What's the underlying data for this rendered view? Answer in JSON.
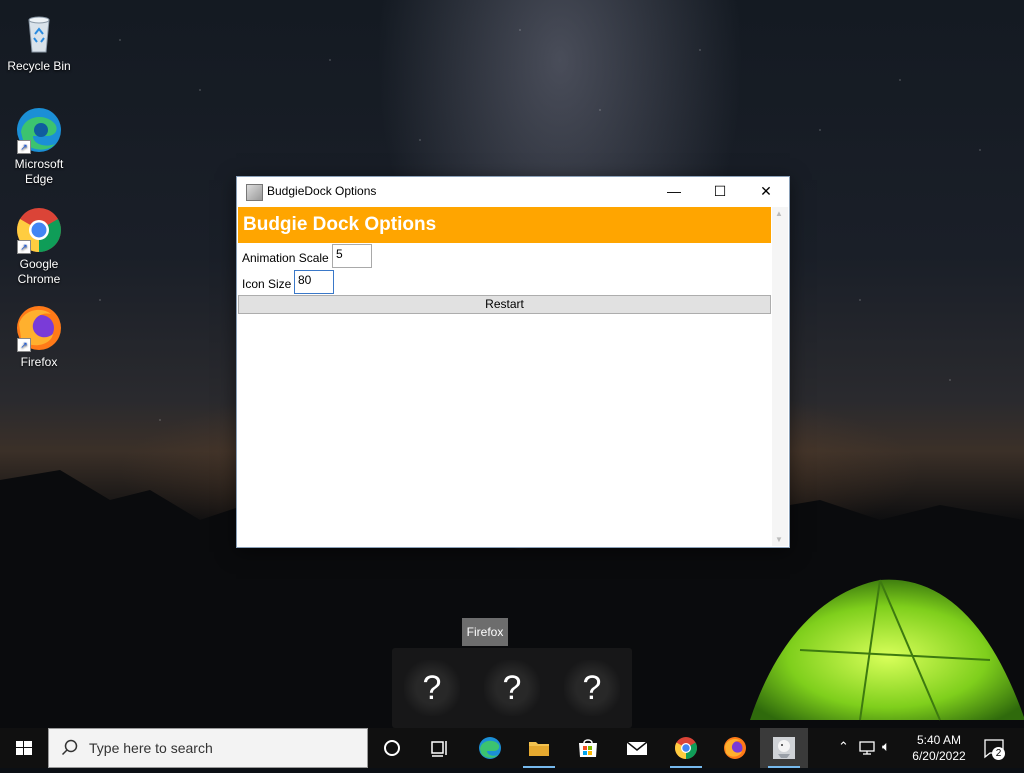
{
  "desktop": {
    "icons": [
      {
        "label": "Recycle Bin"
      },
      {
        "label": "Microsoft Edge"
      },
      {
        "label": "Google Chrome"
      },
      {
        "label": "Firefox"
      }
    ]
  },
  "window": {
    "title": "BudgieDock Options",
    "controls": {
      "minimize": "—",
      "maximize": "☐",
      "close": "✕"
    },
    "banner": "Budgie Dock Options",
    "fields": [
      {
        "label": "Animation Scale",
        "value": "5"
      },
      {
        "label": "Icon Size",
        "value": "80"
      }
    ],
    "restart_label": "Restart",
    "accent_color": "#ffa500"
  },
  "dock": {
    "tooltip": "Firefox",
    "items": [
      {
        "glyph": "?"
      },
      {
        "glyph": "?"
      },
      {
        "glyph": "?"
      }
    ]
  },
  "taskbar": {
    "search_placeholder": "Type here to search",
    "pinned": [
      "cortana-icon",
      "task-view-icon",
      "edge-icon",
      "file-explorer-icon",
      "store-icon",
      "mail-icon",
      "chrome-icon",
      "firefox-icon",
      "budgiedock-icon"
    ],
    "clock": {
      "time": "5:40 AM",
      "date": "6/20/2022"
    },
    "notifications": "2"
  }
}
